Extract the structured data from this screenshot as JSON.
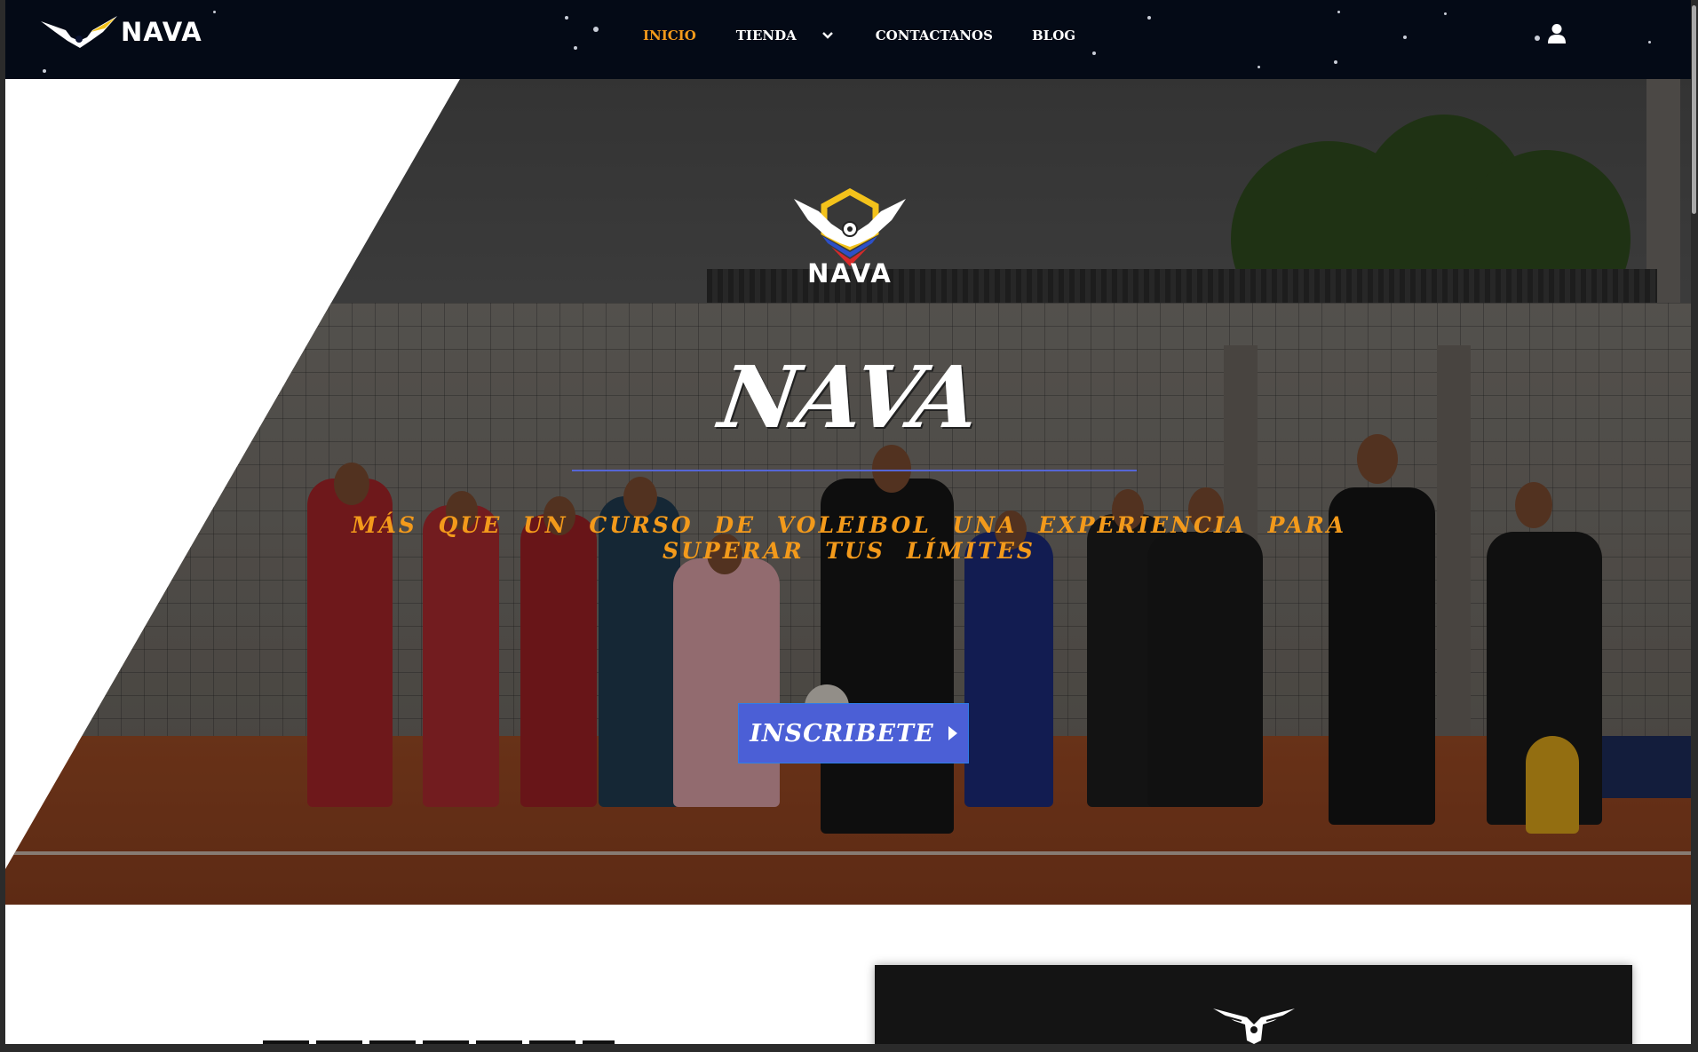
{
  "navbar": {
    "brand": "NAVA",
    "items": [
      {
        "label": "INICIO",
        "active": true
      },
      {
        "label": "TIENDA",
        "active": false,
        "has_dropdown": true
      },
      {
        "label": "CONTACTANOS",
        "active": false
      },
      {
        "label": "BLOG",
        "active": false
      }
    ],
    "user_icon": "user-icon"
  },
  "hero": {
    "logo_text": "NAVA",
    "title": "NAVA",
    "subtitle": "MÁS QUE UN CURSO DE VOLEIBOL  UNA EXPERIENCIA PARA SUPERAR TUS LÍMITES",
    "cta_label": "INSCRIBETE"
  },
  "colors": {
    "navbar_bg": "#040a16",
    "accent_orange": "#f39a1b",
    "button_blue": "#4b5fd6",
    "rule_blue": "#5566d6"
  }
}
